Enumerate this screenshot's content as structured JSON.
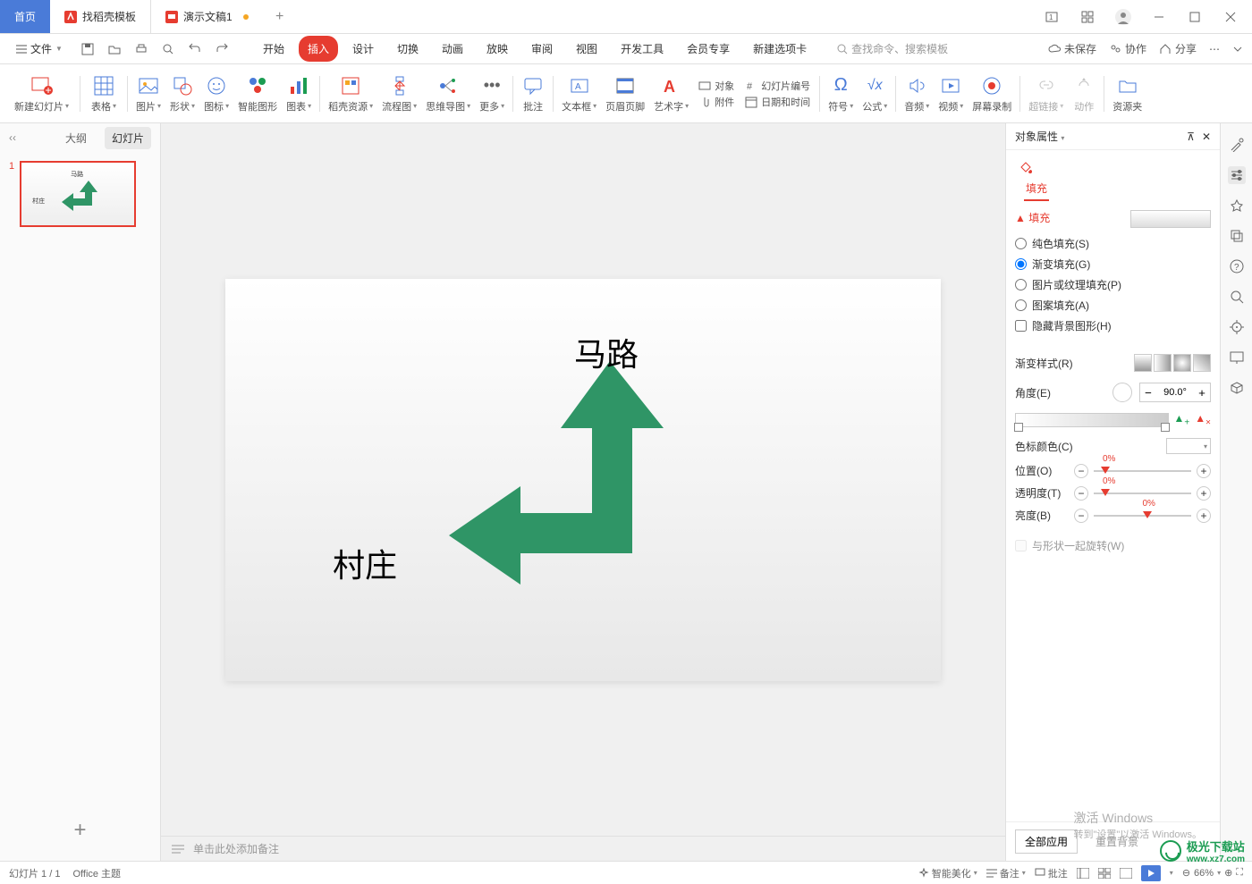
{
  "titlebar": {
    "home_tab": "首页",
    "template_tab": "找稻壳模板",
    "doc_tab": "演示文稿1",
    "add_tab": "+"
  },
  "menubar": {
    "file_label": "文件",
    "tabs": [
      "开始",
      "插入",
      "设计",
      "切换",
      "动画",
      "放映",
      "审阅",
      "视图",
      "开发工具",
      "会员专享",
      "新建选项卡"
    ],
    "active_index": 1,
    "search_placeholder": "查找命令、搜索模板",
    "unsaved": "未保存",
    "collab": "协作",
    "share": "分享"
  },
  "ribbon": {
    "new_slide": "新建幻灯片",
    "table": "表格",
    "picture": "图片",
    "shape": "形状",
    "icon": "图标",
    "smart": "智能图形",
    "chart": "图表",
    "resource": "稻壳资源",
    "flowchart": "流程图",
    "mindmap": "思维导图",
    "more": "更多",
    "comment": "批注",
    "textbox": "文本框",
    "header_footer": "页眉页脚",
    "art_text": "艺术字",
    "object": "对象",
    "attachment": "附件",
    "slide_number": "幻灯片编号",
    "datetime": "日期和时间",
    "symbol": "符号",
    "equation": "公式",
    "audio": "音频",
    "video": "视频",
    "screen_rec": "屏幕录制",
    "hyperlink": "超链接",
    "action": "动作",
    "resource_pack": "资源夹"
  },
  "left": {
    "outline": "大纲",
    "slides": "幻灯片",
    "thumb_num": "1"
  },
  "slide": {
    "road": "马路",
    "village": "村庄"
  },
  "notes": {
    "placeholder": "单击此处添加备注"
  },
  "right_panel": {
    "title": "对象属性",
    "fill_tab": "填充",
    "section": "填充",
    "solid_fill": "纯色填充(S)",
    "gradient_fill": "渐变填充(G)",
    "texture_fill": "图片或纹理填充(P)",
    "pattern_fill": "图案填充(A)",
    "hide_bg": "隐藏背景图形(H)",
    "gradient_style": "渐变样式(R)",
    "angle": "角度(E)",
    "angle_val": "90.0°",
    "color": "色标颜色(C)",
    "position": "位置(O)",
    "position_val": "0%",
    "transparency": "透明度(T)",
    "transparency_val": "0%",
    "brightness": "亮度(B)",
    "brightness_val": "0%",
    "rotate_with_shape": "与形状一起旋转(W)",
    "apply_all": "全部应用",
    "reset_bg": "重置背景"
  },
  "statusbar": {
    "slide_count": "幻灯片 1 / 1",
    "theme": "Office 主题",
    "beautify": "智能美化",
    "notes_btn": "备注",
    "comment_btn": "批注",
    "zoom": "66%"
  },
  "watermarks": {
    "activate": "激活 Windows",
    "activate_sub": "转到\"设置\"以激活 Windows。",
    "site_name": "极光下载站",
    "site_url": "www.xz7.com"
  }
}
